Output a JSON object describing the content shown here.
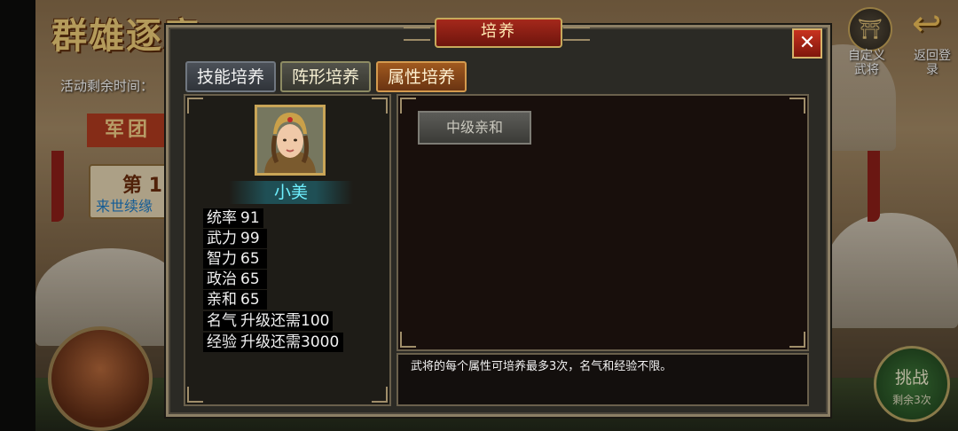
{
  "background": {
    "event_title": "群雄逐鹿",
    "remaining_time_label": "活动剩余时间：",
    "legion_label": "军团",
    "rank_label": "第 1",
    "rank_sub": "来世续缘",
    "custom_general_label": "自定义武将",
    "return_login_label": "返回登录",
    "challenge_label": "挑战",
    "challenge_remaining": "剩余3次"
  },
  "dialog": {
    "title": "培养",
    "close_glyph": "✕",
    "tabs": [
      {
        "label": "技能培养",
        "state": "normal"
      },
      {
        "label": "阵形培养",
        "state": "normal"
      },
      {
        "label": "属性培养",
        "state": "selected"
      }
    ],
    "general": {
      "name": "小美",
      "stats": [
        {
          "label": "统率",
          "value": "91"
        },
        {
          "label": "武力",
          "value": "99"
        },
        {
          "label": "智力",
          "value": "65"
        },
        {
          "label": "政治",
          "value": "65"
        },
        {
          "label": "亲和",
          "value": "65"
        },
        {
          "label": "名气",
          "value": "升级还需100"
        },
        {
          "label": "经验",
          "value": "升级还需3000"
        }
      ]
    },
    "attribute_buttons": [
      {
        "label": "中级亲和"
      }
    ],
    "description": "武将的每个属性可培养最多3次，名气和经验不限。"
  },
  "icons": {
    "close": "close-icon",
    "return": "return-arrow-icon",
    "custom_general": "temple-icon"
  },
  "colors": {
    "name_color": "#6ff0ff",
    "title_bar": "#a5281b",
    "selected_tab": "#a0591f"
  }
}
